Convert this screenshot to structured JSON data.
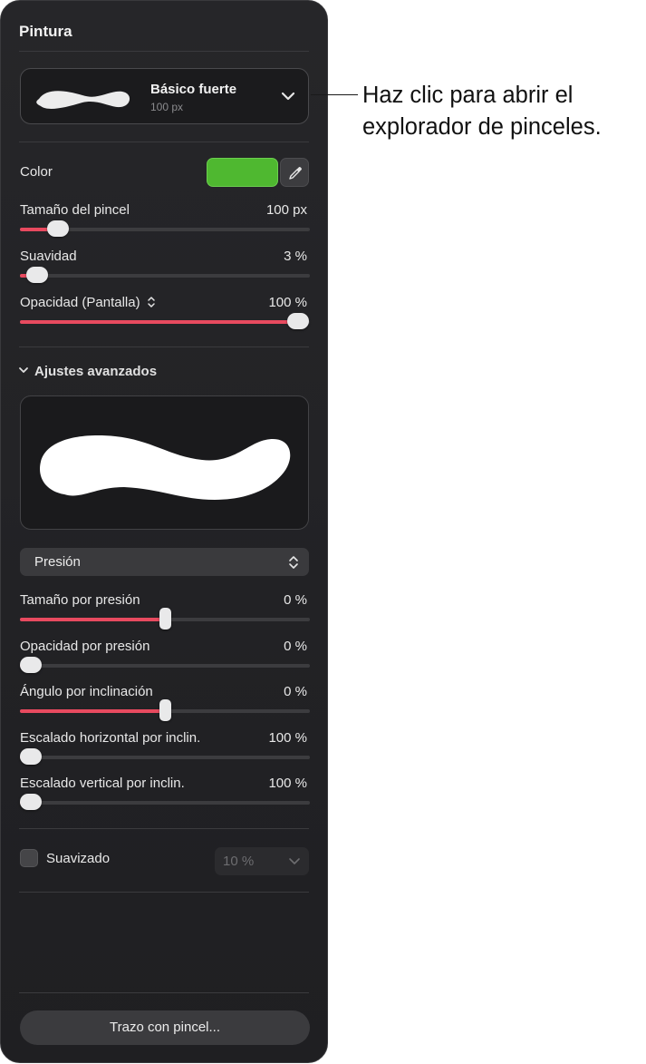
{
  "panel": {
    "title": "Pintura",
    "brush": {
      "name": "Básico fuerte",
      "size": "100 px"
    },
    "color": {
      "label": "Color",
      "swatch": "#4fb830"
    },
    "sliders": [
      {
        "label": "Tamaño del pincel",
        "value": "100 px",
        "fraction": 0.13
      },
      {
        "label": "Suavidad",
        "value": "3 %",
        "fraction": 0.06
      },
      {
        "label": "Opacidad (Pantalla)",
        "value": "100 %",
        "fraction": 0.96
      }
    ],
    "advanced": {
      "label": "Ajustes avanzados",
      "mode": "Presión",
      "sliders": [
        {
          "label": "Tamaño por presión",
          "value": "0 %",
          "fraction": 0.5
        },
        {
          "label": "Opacidad por presión",
          "value": "0 %",
          "fraction": 0.035
        },
        {
          "label": "Ángulo por inclinación",
          "value": "0 %",
          "fraction": 0.5
        },
        {
          "label": "Escalado horizontal por inclin.",
          "value": "100 %",
          "fraction": 0.035
        },
        {
          "label": "Escalado vertical por inclin.",
          "value": "100 %",
          "fraction": 0.035
        }
      ]
    },
    "smoothing": {
      "label": "Suavizado",
      "value": "10 %",
      "checked": false
    },
    "stroke_button": "Trazo con pincel..."
  },
  "callout": {
    "text": "Haz clic para abrir el explorador de pinceles."
  },
  "colors": {
    "accent": "#e84a5f",
    "panel_bg": "#222225",
    "swatch": "#4fb830"
  }
}
